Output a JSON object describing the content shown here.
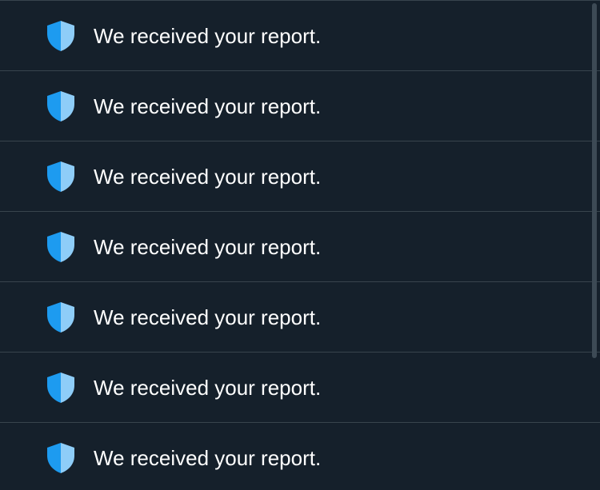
{
  "notifications": [
    {
      "icon": "shield-icon",
      "text": "We received your report."
    },
    {
      "icon": "shield-icon",
      "text": "We received your report."
    },
    {
      "icon": "shield-icon",
      "text": "We received your report."
    },
    {
      "icon": "shield-icon",
      "text": "We received your report."
    },
    {
      "icon": "shield-icon",
      "text": "We received your report."
    },
    {
      "icon": "shield-icon",
      "text": "We received your report."
    },
    {
      "icon": "shield-icon",
      "text": "We received your report."
    }
  ],
  "colors": {
    "background": "#15202b",
    "divider": "#38444d",
    "text": "#ffffff",
    "shield_dark": "#1d9bf0",
    "shield_light": "#8ecdf8"
  }
}
